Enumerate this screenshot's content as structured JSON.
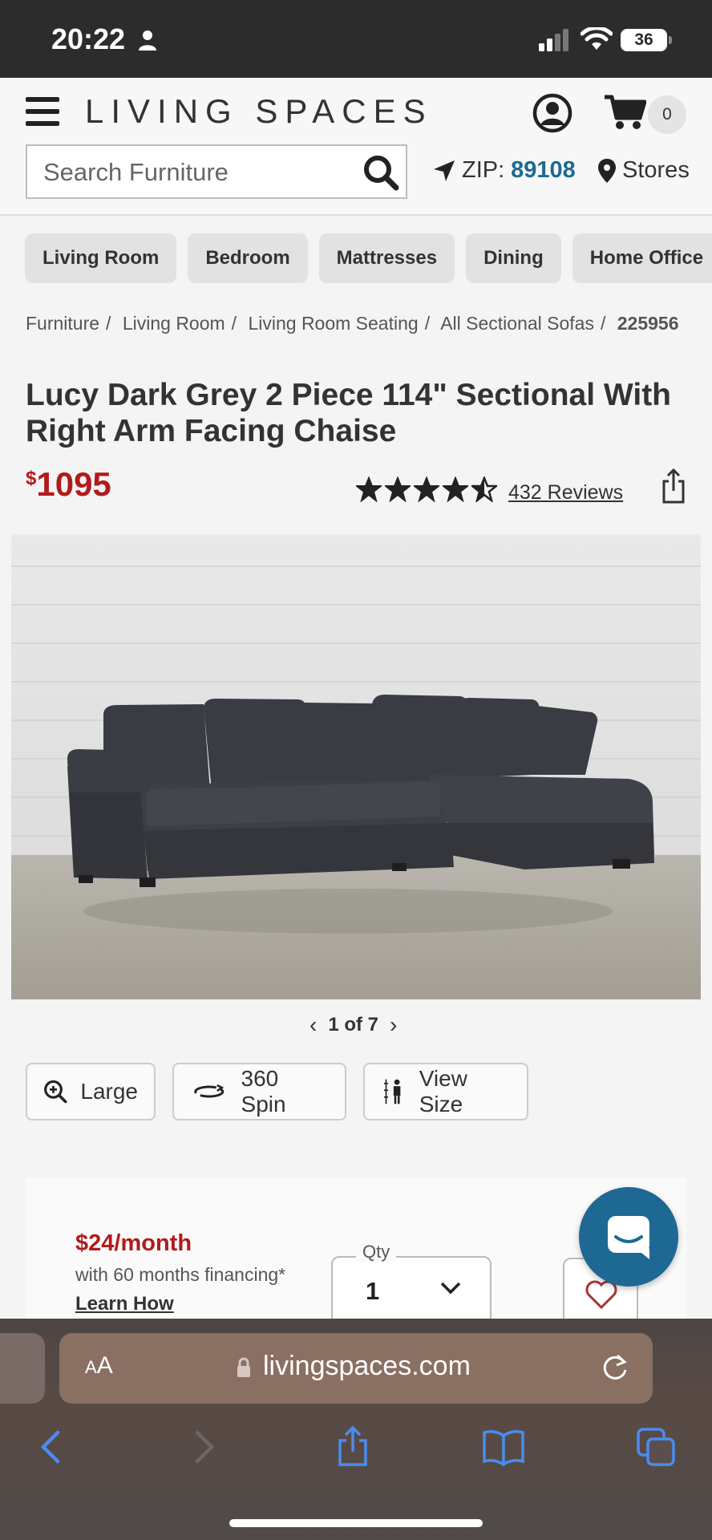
{
  "status_bar": {
    "time": "20:22",
    "battery": "36"
  },
  "header": {
    "logo": "LIVING SPACES",
    "cart_count": "0",
    "search_placeholder": "Search Furniture",
    "zip_label": "ZIP:",
    "zip_code": "89108",
    "stores_label": "Stores"
  },
  "categories": [
    "Living Room",
    "Bedroom",
    "Mattresses",
    "Dining",
    "Home Office"
  ],
  "breadcrumb": {
    "items": [
      "Furniture",
      "Living Room",
      "Living Room Seating",
      "All Sectional Sofas"
    ],
    "sku": "225956"
  },
  "product": {
    "title": "Lucy Dark Grey 2 Piece 114\" Sectional With Right Arm Facing Chaise",
    "price_currency": "$",
    "price": "1095",
    "rating": 4.5,
    "reviews_label": "432 Reviews",
    "image_counter": "1 of 7"
  },
  "tools": {
    "large": "Large",
    "spin": "360 Spin",
    "view_size": "View Size"
  },
  "purchase": {
    "monthly": "$24/month",
    "financing": "with 60 months financing*",
    "learn_how": "Learn How",
    "qty_label": "Qty",
    "qty_value": "1"
  },
  "browser": {
    "aa_label": "AA",
    "url": "livingspaces.com"
  },
  "colors": {
    "price_red": "#b11b1b",
    "zip_blue": "#1d6b93",
    "chat_blue": "#1e6894"
  }
}
